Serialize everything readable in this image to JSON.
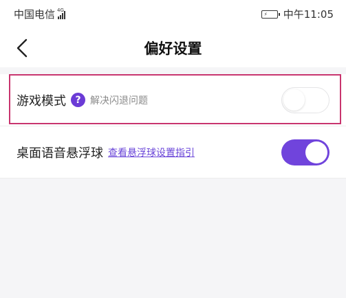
{
  "status_bar": {
    "carrier": "中国电信",
    "network": "4G",
    "time": "中午11:05"
  },
  "nav": {
    "back_icon": "chevron-left-icon",
    "title": "偏好设置"
  },
  "settings": {
    "game_mode": {
      "label": "游戏模式",
      "help_icon": "question-icon",
      "help_glyph": "?",
      "hint": "解决闪退问题",
      "enabled": false
    },
    "voice_ball": {
      "label": "桌面语音悬浮球",
      "link": "查看悬浮球设置指引",
      "enabled": true
    }
  },
  "colors": {
    "accent": "#7044dc",
    "highlight_border": "#c8346e",
    "link": "#6a45d8"
  }
}
